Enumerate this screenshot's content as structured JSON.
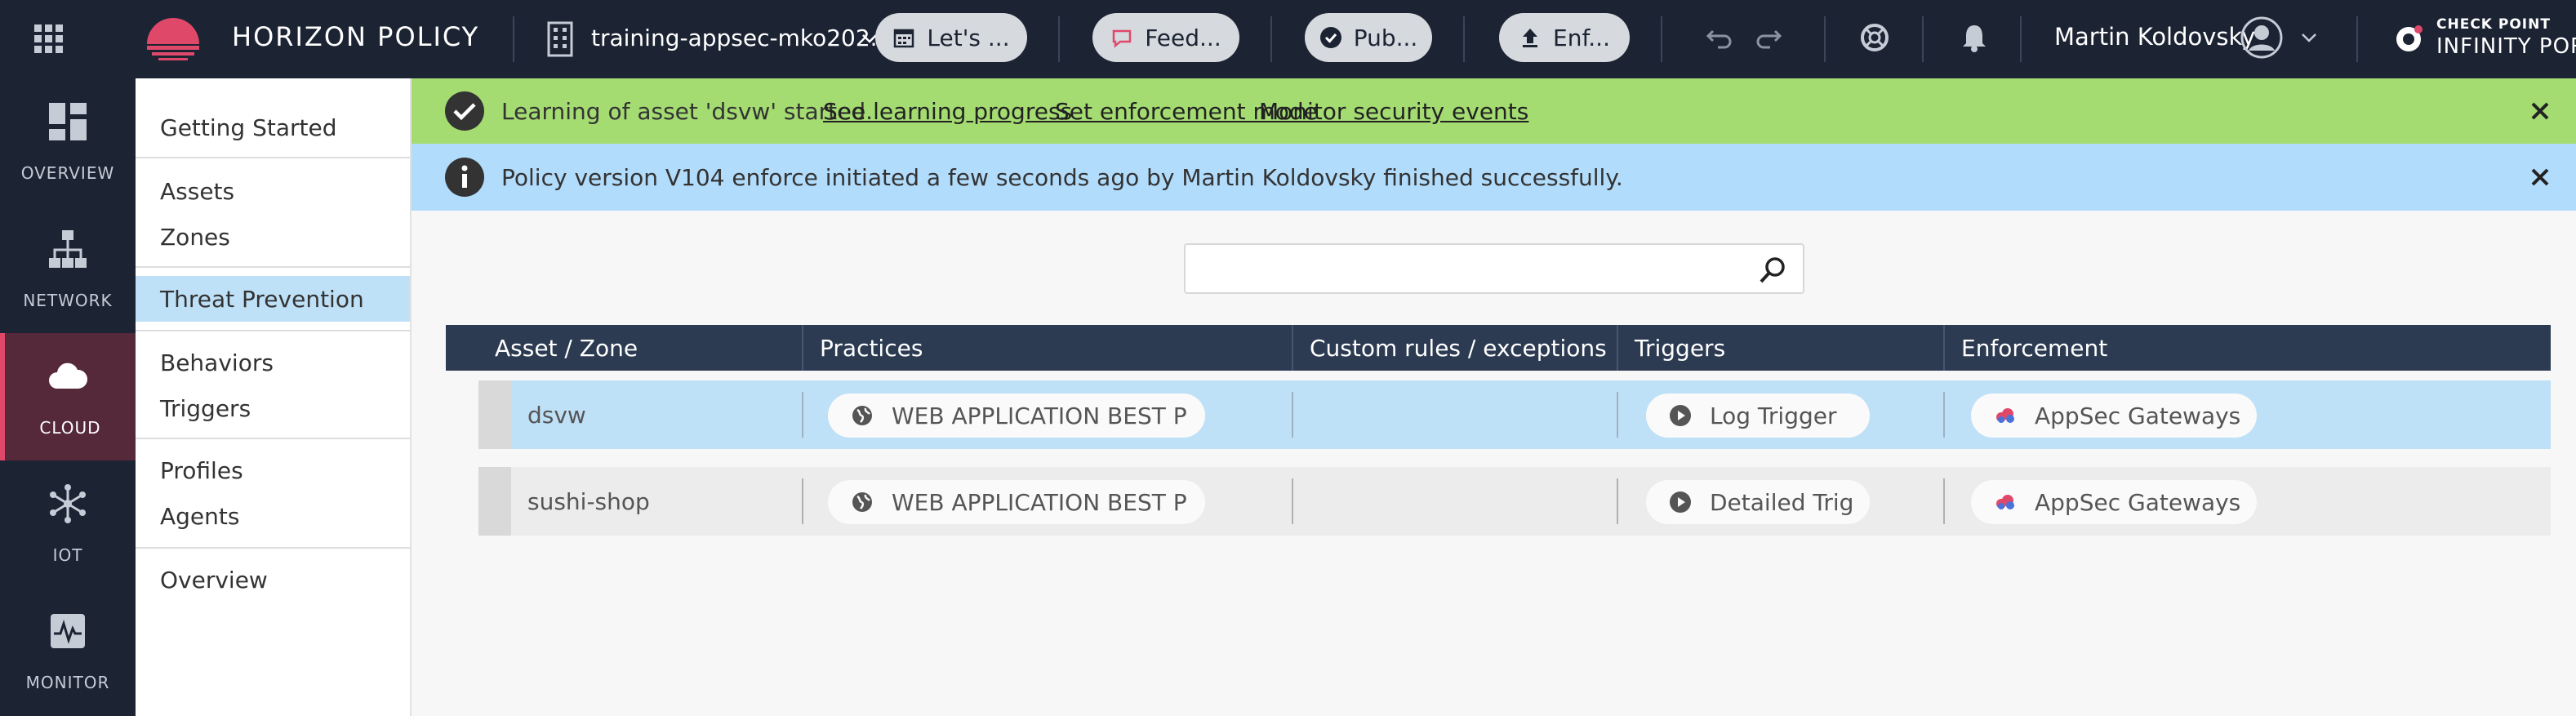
{
  "topbar": {
    "brand": "HORIZON POLICY",
    "tenant": "training-appsec-mko202...",
    "buttons": [
      {
        "label": "Let's ...",
        "icon": "calendar-icon"
      },
      {
        "label": "Feed...",
        "icon": "feedback-icon"
      },
      {
        "label": "Pub...",
        "icon": "check-circle-icon"
      },
      {
        "label": "Enf...",
        "icon": "upload-icon"
      }
    ],
    "user_name": "Martin Koldovsky",
    "product_line1": "CHECK POINT",
    "product_line2": "INFINITY PORT",
    "brand_color": "#e0486a"
  },
  "rail": {
    "items": [
      {
        "label": "OVERVIEW",
        "icon": "dashboard-icon",
        "active": false
      },
      {
        "label": "NETWORK",
        "icon": "network-icon",
        "active": false
      },
      {
        "label": "CLOUD",
        "icon": "cloud-icon",
        "active": true
      },
      {
        "label": "IOT",
        "icon": "iot-icon",
        "active": false
      },
      {
        "label": "MONITOR",
        "icon": "monitor-icon",
        "active": false
      }
    ]
  },
  "menu": {
    "items": [
      "Getting Started",
      "Assets",
      "Zones",
      "Threat Prevention",
      "Behaviors",
      "Triggers",
      "Profiles",
      "Agents",
      "Overview"
    ],
    "active": "Threat Prevention"
  },
  "banners": {
    "success": {
      "text": "Learning of asset 'dsvw' started.",
      "links": [
        "See learning progress",
        "Set enforcement mode",
        "Monitor security events"
      ],
      "color": "#a4dc72"
    },
    "info": {
      "text": "Policy version V104 enforce initiated a few seconds ago by Martin Koldovsky finished successfully.",
      "color": "#b2dcfb"
    }
  },
  "search": {
    "value": "",
    "placeholder": ""
  },
  "table": {
    "columns": [
      "Asset / Zone",
      "Practices",
      "Custom rules / exceptions",
      "Triggers",
      "Enforcement"
    ],
    "rows": [
      {
        "name": "dsvw",
        "practice": "WEB APPLICATION BEST PR.",
        "custom": "",
        "trigger": "Log Trigger",
        "enforcement": "AppSec Gateways",
        "selected": true
      },
      {
        "name": "sushi-shop",
        "practice": "WEB APPLICATION BEST PR.",
        "custom": "",
        "trigger": "Detailed Trig",
        "enforcement": "AppSec Gateways",
        "selected": false
      }
    ]
  }
}
